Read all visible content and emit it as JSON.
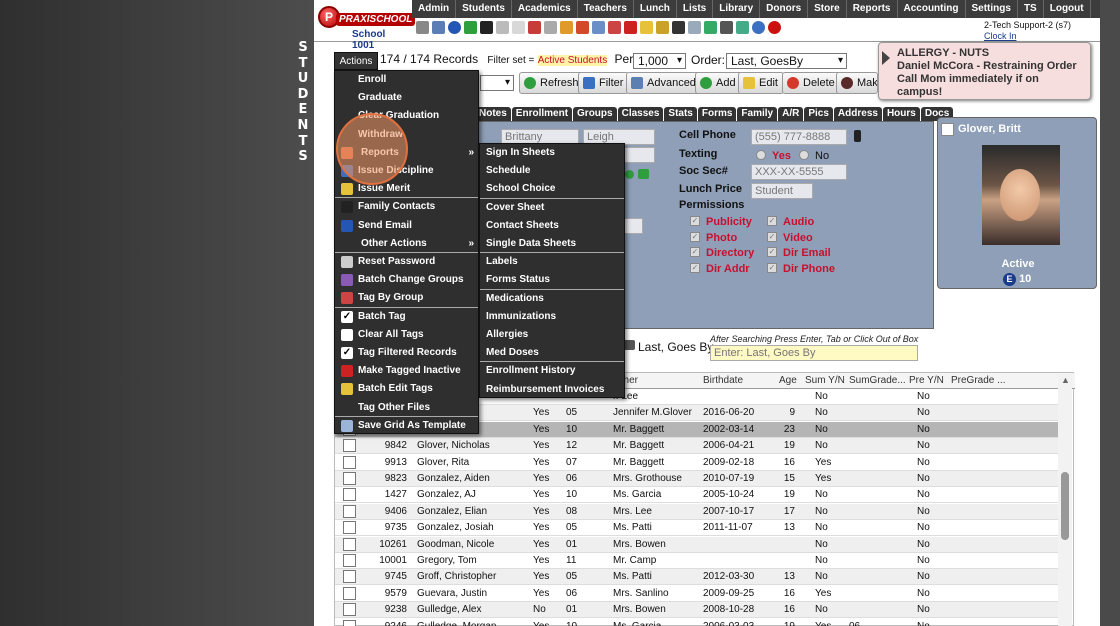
{
  "side_label": "STUDENTS",
  "logo": {
    "badge": "P",
    "brand": "PRAXISCHOOL",
    "school": "School 1001"
  },
  "nav": [
    "Admin",
    "Students",
    "Academics",
    "Teachers",
    "Lunch",
    "Lists",
    "Library",
    "Donors",
    "Store",
    "Reports",
    "Accounting",
    "Settings",
    "TS",
    "Logout"
  ],
  "toolbar_icons": [
    "search-icon",
    "grid-icon",
    "at-icon",
    "chat-icon",
    "phone-icon",
    "megaphone-icon",
    "mail-icon",
    "calendar-icon",
    "ticket-icon",
    "warning-icon",
    "alert-icon",
    "document-icon",
    "chart-icon",
    "pdf-icon",
    "folder-icon",
    "shield-icon",
    "calculator-icon",
    "list-icon",
    "image-icon",
    "keyboard-icon",
    "money-icon",
    "help-icon",
    "power-icon"
  ],
  "user": {
    "line1": "2-Tech Support-2 (s7)",
    "clock_in": "Clock In"
  },
  "alert": {
    "line1": "ALLERGY - NUTS",
    "line2": "Daniel McCora - Restraining Order",
    "line3": "Call Mom immediately if on campus!"
  },
  "records": {
    "count": "174 / 174 Records",
    "filter_label": "Filter set =",
    "filter_value": "Active Students",
    "per_page_label": "Per Page:",
    "per_page_value": "1,000",
    "order_label": "Order:",
    "order_value": "Last, GoesBy"
  },
  "buttons": {
    "refresh": "Refresh",
    "filter": "Filter",
    "advanced": "Advanced",
    "add": "Add",
    "edit": "Edit",
    "delete": "Delete",
    "make": "Make"
  },
  "tabs": [
    "Notes",
    "Enrollment",
    "Groups",
    "Classes",
    "Stats",
    "Forms",
    "Family",
    "A/R",
    "Pics",
    "Address",
    "Hours",
    "Docs"
  ],
  "form": {
    "first_name": "Brittany",
    "middle_name": "Leigh",
    "cell_phone_label": "Cell Phone",
    "cell_phone": "(555) 777-8888",
    "texting_label": "Texting",
    "yes": "Yes",
    "no": "No",
    "ssn_label": "Soc Sec#",
    "ssn": "XXX-XX-5555",
    "lunch_label": "Lunch Price",
    "lunch_value": "Student",
    "permissions_label": "Permissions",
    "perms_left": [
      "Publicity",
      "Photo",
      "Directory",
      "Dir Addr"
    ],
    "perms_right": [
      "Audio",
      "Video",
      "Dir Email",
      "Dir Phone"
    ]
  },
  "student_card": {
    "name": "Glover, Britt",
    "status": "Active",
    "badge": "E",
    "grade": "10"
  },
  "search": {
    "label": "Last, Goes By",
    "hint": "After Searching Press Enter, Tab or Click Out of Box",
    "placeholder": "Enter: Last, Goes By"
  },
  "grid": {
    "headers": [
      "acher",
      "Birthdate",
      "Age",
      "Sum Y/N",
      "SumGrade...",
      "Pre Y/N",
      "PreGrade ..."
    ],
    "rows": [
      {
        "id": "",
        "name": "",
        "active": "",
        "grade": "",
        "teacher": "r. Lee",
        "birth": "",
        "age": "",
        "sum": "No",
        "sumgrade": "",
        "pre": "No"
      },
      {
        "id": "",
        "name": "",
        "active": "Yes",
        "grade": "05",
        "teacher": "Jennifer M.Glover",
        "birth": "2016-06-20",
        "age": "9",
        "sum": "No",
        "sumgrade": "",
        "pre": "No"
      },
      {
        "id": "",
        "name": "",
        "active": "Yes",
        "grade": "10",
        "teacher": "Mr. Baggett",
        "birth": "2002-03-14",
        "age": "23",
        "sum": "No",
        "sumgrade": "",
        "pre": "No"
      },
      {
        "id": "9842",
        "name": "Glover, Nicholas",
        "active": "Yes",
        "grade": "12",
        "teacher": "Mr. Baggett",
        "birth": "2006-04-21",
        "age": "19",
        "sum": "No",
        "sumgrade": "",
        "pre": "No"
      },
      {
        "id": "9913",
        "name": "Glover, Rita",
        "active": "Yes",
        "grade": "07",
        "teacher": "Mr. Baggett",
        "birth": "2009-02-18",
        "age": "16",
        "sum": "Yes",
        "sumgrade": "",
        "pre": "No"
      },
      {
        "id": "9823",
        "name": "Gonzalez, Aiden",
        "active": "Yes",
        "grade": "06",
        "teacher": "Mrs. Grothouse",
        "birth": "2010-07-19",
        "age": "15",
        "sum": "Yes",
        "sumgrade": "",
        "pre": "No"
      },
      {
        "id": "1427",
        "name": "Gonzalez, AJ",
        "active": "Yes",
        "grade": "10",
        "teacher": "Ms. Garcia",
        "birth": "2005-10-24",
        "age": "19",
        "sum": "No",
        "sumgrade": "",
        "pre": "No"
      },
      {
        "id": "9406",
        "name": "Gonzalez, Elian",
        "active": "Yes",
        "grade": "08",
        "teacher": "Mrs. Lee",
        "birth": "2007-10-17",
        "age": "17",
        "sum": "No",
        "sumgrade": "",
        "pre": "No"
      },
      {
        "id": "9735",
        "name": "Gonzalez, Josiah",
        "active": "Yes",
        "grade": "05",
        "teacher": "Ms. Patti",
        "birth": "2011-11-07",
        "age": "13",
        "sum": "No",
        "sumgrade": "",
        "pre": "No"
      },
      {
        "id": "10261",
        "name": "Goodman, Nicole",
        "active": "Yes",
        "grade": "01",
        "teacher": "Mrs. Bowen",
        "birth": "",
        "age": "",
        "sum": "No",
        "sumgrade": "",
        "pre": "No"
      },
      {
        "id": "10001",
        "name": "Gregory, Tom",
        "active": "Yes",
        "grade": "11",
        "teacher": "Mr. Camp",
        "birth": "",
        "age": "",
        "sum": "No",
        "sumgrade": "",
        "pre": "No"
      },
      {
        "id": "9745",
        "name": "Groff, Christopher",
        "active": "Yes",
        "grade": "05",
        "teacher": "Ms. Patti",
        "birth": "2012-03-30",
        "age": "13",
        "sum": "No",
        "sumgrade": "",
        "pre": "No"
      },
      {
        "id": "9579",
        "name": "Guevara, Justin",
        "active": "Yes",
        "grade": "06",
        "teacher": "Mrs. Sanlino",
        "birth": "2009-09-25",
        "age": "16",
        "sum": "Yes",
        "sumgrade": "",
        "pre": "No"
      },
      {
        "id": "9238",
        "name": "Gulledge, Alex",
        "active": "No",
        "grade": "01",
        "teacher": "Mrs. Bowen",
        "birth": "2008-10-28",
        "age": "16",
        "sum": "No",
        "sumgrade": "",
        "pre": "No"
      },
      {
        "id": "9246",
        "name": "Gulledge, Morgan",
        "active": "Yes",
        "grade": "10",
        "teacher": "Ms. Garcia",
        "birth": "2006-03-03",
        "age": "19",
        "sum": "Yes",
        "sumgrade": "06",
        "pre": "No"
      }
    ]
  },
  "actions_button": "Actions",
  "actions_menu": [
    {
      "label": "Enroll",
      "icon": ""
    },
    {
      "label": "Graduate",
      "icon": ""
    },
    {
      "label": "Clear Graduation",
      "icon": ""
    },
    {
      "label": "Withdraw",
      "icon": ""
    },
    {
      "label": "Reports",
      "icon": "report-icon",
      "arrow": "»"
    },
    {
      "label": "Issue Discipline",
      "icon": "discipline-icon"
    },
    {
      "label": "Issue Merit",
      "icon": "merit-icon"
    },
    {
      "label": "Family Contacts",
      "icon": "phone-icon"
    },
    {
      "label": "Send Email",
      "icon": "email-icon"
    },
    {
      "label": "Other Actions",
      "icon": "",
      "arrow": "»"
    },
    {
      "label": "Reset Password",
      "icon": "keyboard-icon"
    },
    {
      "label": "Batch Change Groups",
      "icon": "groups-icon"
    },
    {
      "label": "Tag By Group",
      "icon": "tag-icon"
    },
    {
      "label": "Batch Tag",
      "icon": "checkbox-checked-icon"
    },
    {
      "label": "Clear All Tags",
      "icon": "checkbox-empty-icon"
    },
    {
      "label": "Tag Filtered Records",
      "icon": "checkbox-checked-icon"
    },
    {
      "label": "Make Tagged Inactive",
      "icon": "inactive-icon"
    },
    {
      "label": "Batch Edit Tags",
      "icon": "pencil-icon"
    },
    {
      "label": "Tag Other Files",
      "icon": ""
    },
    {
      "label": "Save Grid As Template",
      "icon": "grid-icon"
    }
  ],
  "reports_menu": [
    "Sign In Sheets",
    "Schedule",
    "School Choice",
    "Cover Sheet",
    "Contact Sheets",
    "Single Data Sheets",
    "Labels",
    "Forms Status",
    "Medications",
    "Immunizations",
    "Allergies",
    "Med Doses",
    "Enrollment History",
    "Reimbursement Invoices"
  ],
  "colors": {
    "nav": "#3c3c3c",
    "form": "#8e9fb7",
    "menu": "#2f2f2f",
    "alert": "#f7dede",
    "accent_red": "#c8102e",
    "highlight": "#e0703e"
  }
}
